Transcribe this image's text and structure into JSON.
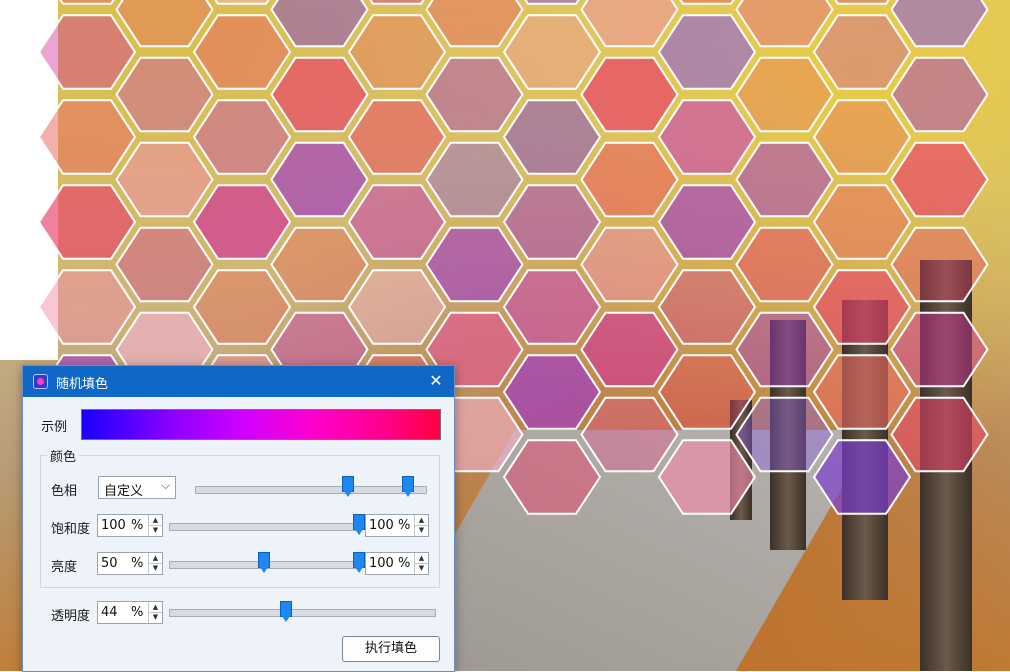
{
  "dialog": {
    "title": "随机填色",
    "close_icon": "close-icon",
    "app_icon": "app-icon",
    "preview_label": "示例",
    "preview_colors": [
      "#1a00ff",
      "#8a00ff",
      "#d000ff",
      "#ff00cc",
      "#ff0088",
      "#ff0040"
    ],
    "color_group_label": "颜色",
    "hue": {
      "label": "色相",
      "mode": "自定义",
      "range": [
        0.66,
        0.92
      ]
    },
    "saturation": {
      "label": "饱和度",
      "min": "100",
      "max": "100",
      "unit": "%",
      "range": [
        1.0,
        1.0
      ]
    },
    "brightness": {
      "label": "亮度",
      "min": "50",
      "max": "100",
      "unit": "%",
      "range": [
        0.5,
        1.0
      ]
    },
    "opacity": {
      "label": "透明度",
      "value": "44",
      "unit": "%",
      "level": 0.44
    },
    "execute_button": "执行填色"
  },
  "canvas": {
    "hex_fill_palette": [
      "#e8406a",
      "#d2339a",
      "#a03ac8",
      "#7b3cd0",
      "#e86a60",
      "#f08aa8",
      "#c84ab0",
      "#8a5ae0",
      "#e05a90",
      "#f0b0c8"
    ]
  }
}
